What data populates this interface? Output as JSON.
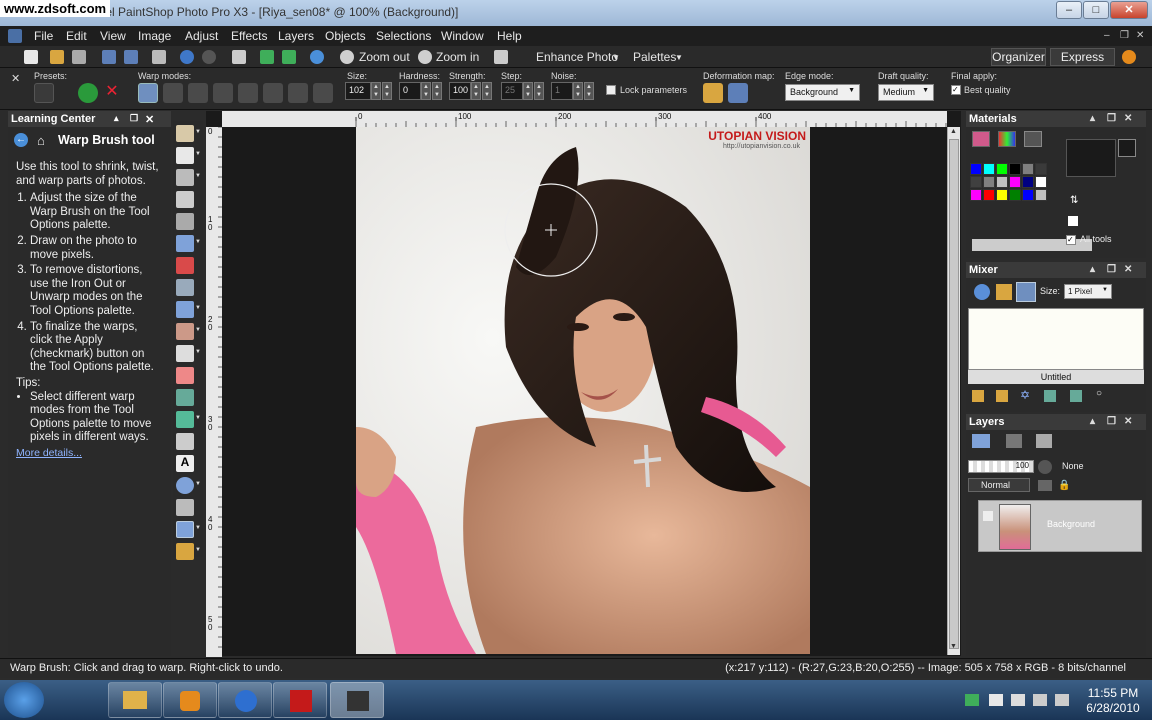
{
  "watermark": "www.zdsoft.com",
  "window": {
    "title": "Corel PaintShop Photo Pro X3 - [Riya_sen08* @ 100% (Background)]"
  },
  "menu": {
    "items": [
      "File",
      "Edit",
      "View",
      "Image",
      "Adjust",
      "Effects",
      "Layers",
      "Objects",
      "Selections",
      "Window",
      "Help"
    ]
  },
  "toolbar": {
    "zoom_out": "Zoom out",
    "zoom_in": "Zoom in",
    "enhance_photo": "Enhance Photo",
    "palettes": "Palettes",
    "organizer": "Organizer",
    "express_lab": "Express Lab"
  },
  "options": {
    "presets_label": "Presets:",
    "warp_modes_label": "Warp modes:",
    "size_label": "Size:",
    "size_value": "102",
    "hardness_label": "Hardness:",
    "hardness_value": "0",
    "strength_label": "Strength:",
    "strength_value": "100",
    "step_label": "Step:",
    "step_value": "25",
    "noise_label": "Noise:",
    "noise_value": "1",
    "lock_params": "Lock parameters",
    "deformation_map_label": "Deformation map:",
    "edge_mode_label": "Edge mode:",
    "edge_mode_value": "Background",
    "draft_quality_label": "Draft quality:",
    "draft_quality_value": "Medium",
    "final_apply_label": "Final apply:",
    "best_quality": "Best quality"
  },
  "learning_center": {
    "panel_title": "Learning Center",
    "tool_title": "Warp Brush tool",
    "intro": "Use this tool to shrink, twist, and warp parts of photos.",
    "steps": [
      "Adjust the size of the Warp Brush on the Tool Options palette.",
      "Draw on the photo to move pixels.",
      "To remove distortions, use the Iron Out or Unwarp modes on the Tool Options palette.",
      "To finalize the warps, click the Apply (checkmark) button on the Tool Options palette."
    ],
    "tips_label": "Tips:",
    "tip": "Select different warp modes from the Tool Options palette to move pixels in different ways.",
    "more_link": "More details..."
  },
  "canvas": {
    "ruler_marks": [
      "0",
      "100",
      "200",
      "300",
      "400"
    ],
    "vruler_marks": [
      "0",
      "1",
      "0",
      "2",
      "0",
      "3",
      "0",
      "4",
      "0",
      "5",
      "0",
      "6"
    ],
    "photo_brand": "UTOPIAN VISION",
    "photo_url": "http://utopianvision.co.uk"
  },
  "materials": {
    "title": "Materials",
    "all_tools": "All tools",
    "swatches": [
      "#0000ff",
      "#00ffff",
      "#00ff00",
      "#000000",
      "#7f7f7f",
      "#3a3a3a",
      "#404040",
      "#808080",
      "#c0c0c0",
      "#ff00ff",
      "#000080",
      "#ffffff",
      "#ff00ff",
      "#ff0000",
      "#ffff00",
      "#008000",
      "#0000ff",
      "#c0c0c0"
    ]
  },
  "mixer": {
    "title": "Mixer",
    "size_label": "Size:",
    "size_value": "1 Pixel",
    "page_name": "Untitled"
  },
  "layers": {
    "title": "Layers",
    "opacity": "100",
    "blend_none": "None",
    "blend_mode": "Normal",
    "layer_name": "Background"
  },
  "status": {
    "left": "Warp Brush: Click and drag to warp. Right-click to undo.",
    "right": "(x:217 y:112) - (R:27,G:23,B:20,O:255) -- Image: 505 x 758 x RGB - 8 bits/channel"
  },
  "taskbar": {
    "time": "11:55 PM",
    "date": "6/28/2010"
  }
}
